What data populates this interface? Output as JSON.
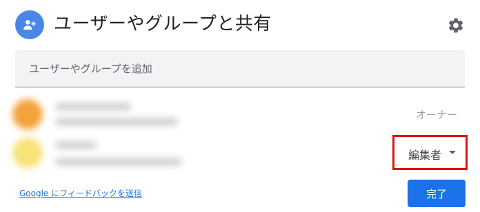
{
  "dialog": {
    "title": "ユーザーやグループと共有",
    "header_icon": "person-add-icon",
    "settings_icon": "gear-icon"
  },
  "search": {
    "placeholder": "ユーザーやグループを追加",
    "value": ""
  },
  "people": [
    {
      "role": "オーナー",
      "avatar_color": "#f4a23b",
      "blurred": true
    },
    {
      "role": "編集者",
      "avatar_color": "#f8e27a",
      "blurred": true,
      "role_is_dropdown": true,
      "highlight_color": "#e01010"
    }
  ],
  "footer": {
    "feedback_link": "Google にフィードバックを送信",
    "done_label": "完了"
  },
  "colors": {
    "primary": "#1a73e8",
    "header_avatar": "#4a86e8",
    "highlight": "#e01010"
  }
}
